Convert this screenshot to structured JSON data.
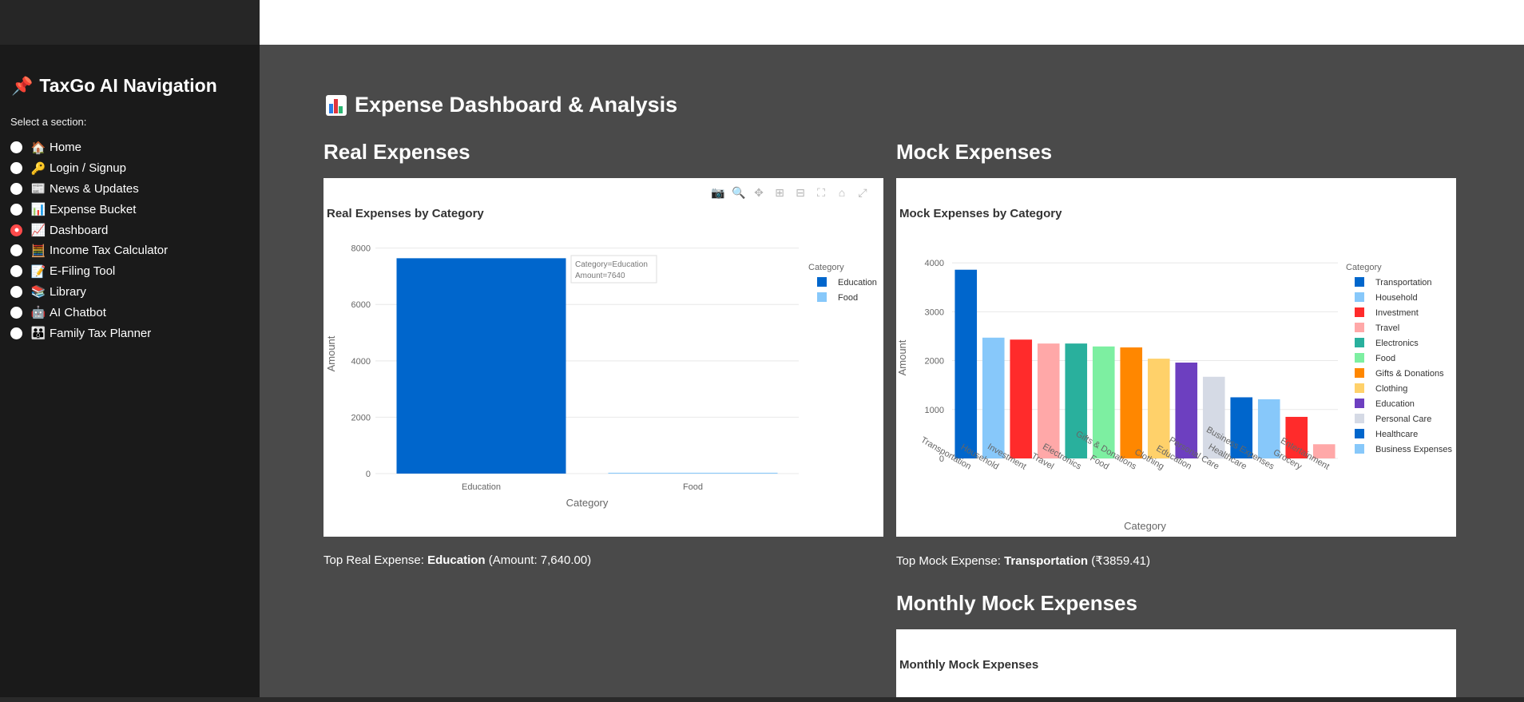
{
  "sidebar": {
    "title": "TaxGo AI Navigation",
    "title_icon": "pushpin-icon",
    "select_label": "Select a section:",
    "items": [
      {
        "emoji": "🏠",
        "label": "Home",
        "selected": false
      },
      {
        "emoji": "🔑",
        "label": "Login / Signup",
        "selected": false
      },
      {
        "emoji": "📰",
        "label": "News & Updates",
        "selected": false
      },
      {
        "emoji": "📊",
        "label": "Expense Bucket",
        "selected": false
      },
      {
        "emoji": "📈",
        "label": "Dashboard",
        "selected": true
      },
      {
        "emoji": "🧮",
        "label": "Income Tax Calculator",
        "selected": false
      },
      {
        "emoji": "📝",
        "label": "E-Filing Tool",
        "selected": false
      },
      {
        "emoji": "📚",
        "label": "Library",
        "selected": false
      },
      {
        "emoji": "🤖",
        "label": "AI Chatbot",
        "selected": false
      },
      {
        "emoji": "👪",
        "label": "Family Tax Planner",
        "selected": false
      }
    ]
  },
  "page": {
    "title": "Expense Dashboard & Analysis",
    "title_icon": "bar-chart-icon"
  },
  "real": {
    "heading": "Real Expenses",
    "chart_title": "Real Expenses by Category",
    "summary_prefix": "Top Real Expense: ",
    "summary_category": "Education",
    "summary_suffix": " (Amount: 7,640.00)",
    "tooltip_line1": "Category=Education",
    "tooltip_line2": "Amount=7640"
  },
  "mock": {
    "heading": "Mock Expenses",
    "chart_title": "Mock Expenses by Category",
    "summary_prefix": "Top Mock Expense: ",
    "summary_category": "Transportation",
    "summary_suffix": " (₹3859.41)"
  },
  "monthly": {
    "heading": "Monthly Mock Expenses",
    "chart_title": "Monthly Mock Expenses"
  },
  "chart_data": [
    {
      "type": "bar",
      "title": "Real Expenses by Category",
      "xlabel": "Category",
      "ylabel": "Amount",
      "legend_title": "Category",
      "legend_position": "top-right",
      "ylim": [
        0,
        8500
      ],
      "yticks": [
        0,
        2000,
        4000,
        6000,
        8000
      ],
      "grid": true,
      "series": [
        {
          "name": "Education",
          "category": "Education",
          "value": 7640,
          "color": "#0066cc"
        },
        {
          "name": "Food",
          "category": "Food",
          "value": 30,
          "color": "#87c8fa"
        }
      ]
    },
    {
      "type": "bar",
      "title": "Mock Expenses by Category",
      "xlabel": "Category",
      "ylabel": "Amount",
      "legend_title": "Category",
      "legend_position": "top-right",
      "ylim": [
        0,
        4100
      ],
      "yticks": [
        0,
        1000,
        2000,
        3000,
        4000
      ],
      "grid": true,
      "series": [
        {
          "name": "Transportation",
          "value": 3859.41,
          "color": "#0066cc"
        },
        {
          "name": "Household",
          "value": 2470,
          "color": "#87c8fa"
        },
        {
          "name": "Investment",
          "value": 2430,
          "color": "#ff2b2b"
        },
        {
          "name": "Travel",
          "value": 2350,
          "color": "#ffa8a8"
        },
        {
          "name": "Electronics",
          "value": 2350,
          "color": "#29b09d"
        },
        {
          "name": "Food",
          "value": 2290,
          "color": "#7defa1"
        },
        {
          "name": "Gifts & Donations",
          "value": 2270,
          "color": "#ff8700"
        },
        {
          "name": "Clothing",
          "value": 2040,
          "color": "#ffd16a"
        },
        {
          "name": "Education",
          "value": 1960,
          "color": "#6d3fc0"
        },
        {
          "name": "Personal Care",
          "value": 1670,
          "color": "#d5dae5"
        },
        {
          "name": "Healthcare",
          "value": 1250,
          "color": "#0066cc"
        },
        {
          "name": "Business Expenses",
          "value": 1210,
          "color": "#87c8fa"
        },
        {
          "name": "Grocery",
          "value": 850,
          "color": "#ff2b2b"
        },
        {
          "name": "Entertainment",
          "value": 290,
          "color": "#ffa8a8"
        }
      ],
      "legend_entries": [
        "Transportation",
        "Household",
        "Investment",
        "Travel",
        "Electronics",
        "Food",
        "Gifts & Donations",
        "Clothing",
        "Education",
        "Personal Care",
        "Healthcare",
        "Business Expenses"
      ]
    }
  ]
}
